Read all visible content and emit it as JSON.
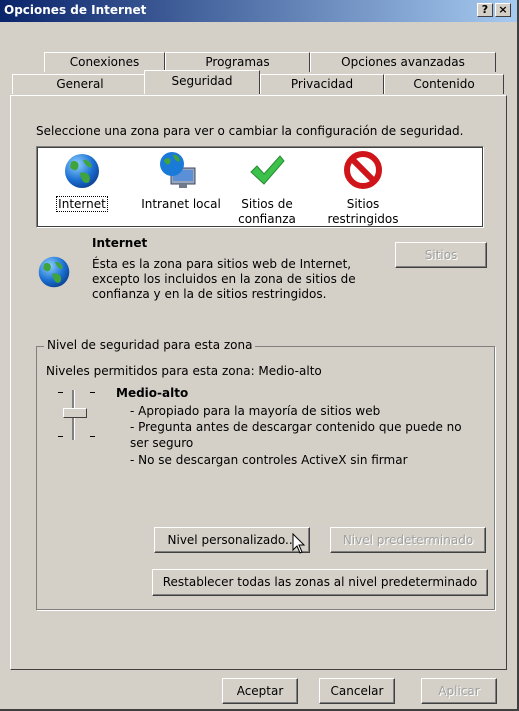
{
  "window": {
    "title": "Opciones de Internet",
    "help_label": "?",
    "close_label": "×"
  },
  "tabs_row1": [
    "Conexiones",
    "Programas",
    "Opciones avanzadas"
  ],
  "tabs_row2": [
    "General",
    "Seguridad",
    "Privacidad",
    "Contenido"
  ],
  "security": {
    "instruction": "Seleccione una zona para ver o cambiar la configuración de seguridad.",
    "zones": [
      {
        "name": "Internet",
        "label1": "Internet",
        "label2": ""
      },
      {
        "name": "Intranet local",
        "label1": "Intranet local",
        "label2": ""
      },
      {
        "name": "Sitios de confianza",
        "label1": "Sitios de",
        "label2": "confianza"
      },
      {
        "name": "Sitios restringidos",
        "label1": "Sitios",
        "label2": "restringidos"
      }
    ],
    "zone_title": "Internet",
    "zone_desc": [
      "Ésta es la zona para sitios web de Internet,",
      "excepto los incluidos en la zona de sitios de",
      "confianza y en la de sitios restringidos."
    ],
    "sites_button": "Sitios",
    "level_group_label": "Nivel de seguridad para esta zona",
    "allowed_levels": "Niveles permitidos para esta zona: Medio-alto",
    "level_name": "Medio-alto",
    "level_details": [
      "- Apropiado para la mayoría de sitios web",
      "- Pregunta antes de descargar contenido que puede no",
      "ser seguro",
      "- No se descargan controles ActiveX sin firmar"
    ],
    "custom_level_button": "Nivel personalizado...",
    "default_level_button": "Nivel predeterminado",
    "reset_all_button": "Restablecer todas las zonas al nivel predeterminado"
  },
  "footer": {
    "ok": "Aceptar",
    "cancel": "Cancelar",
    "apply": "Aplicar"
  }
}
